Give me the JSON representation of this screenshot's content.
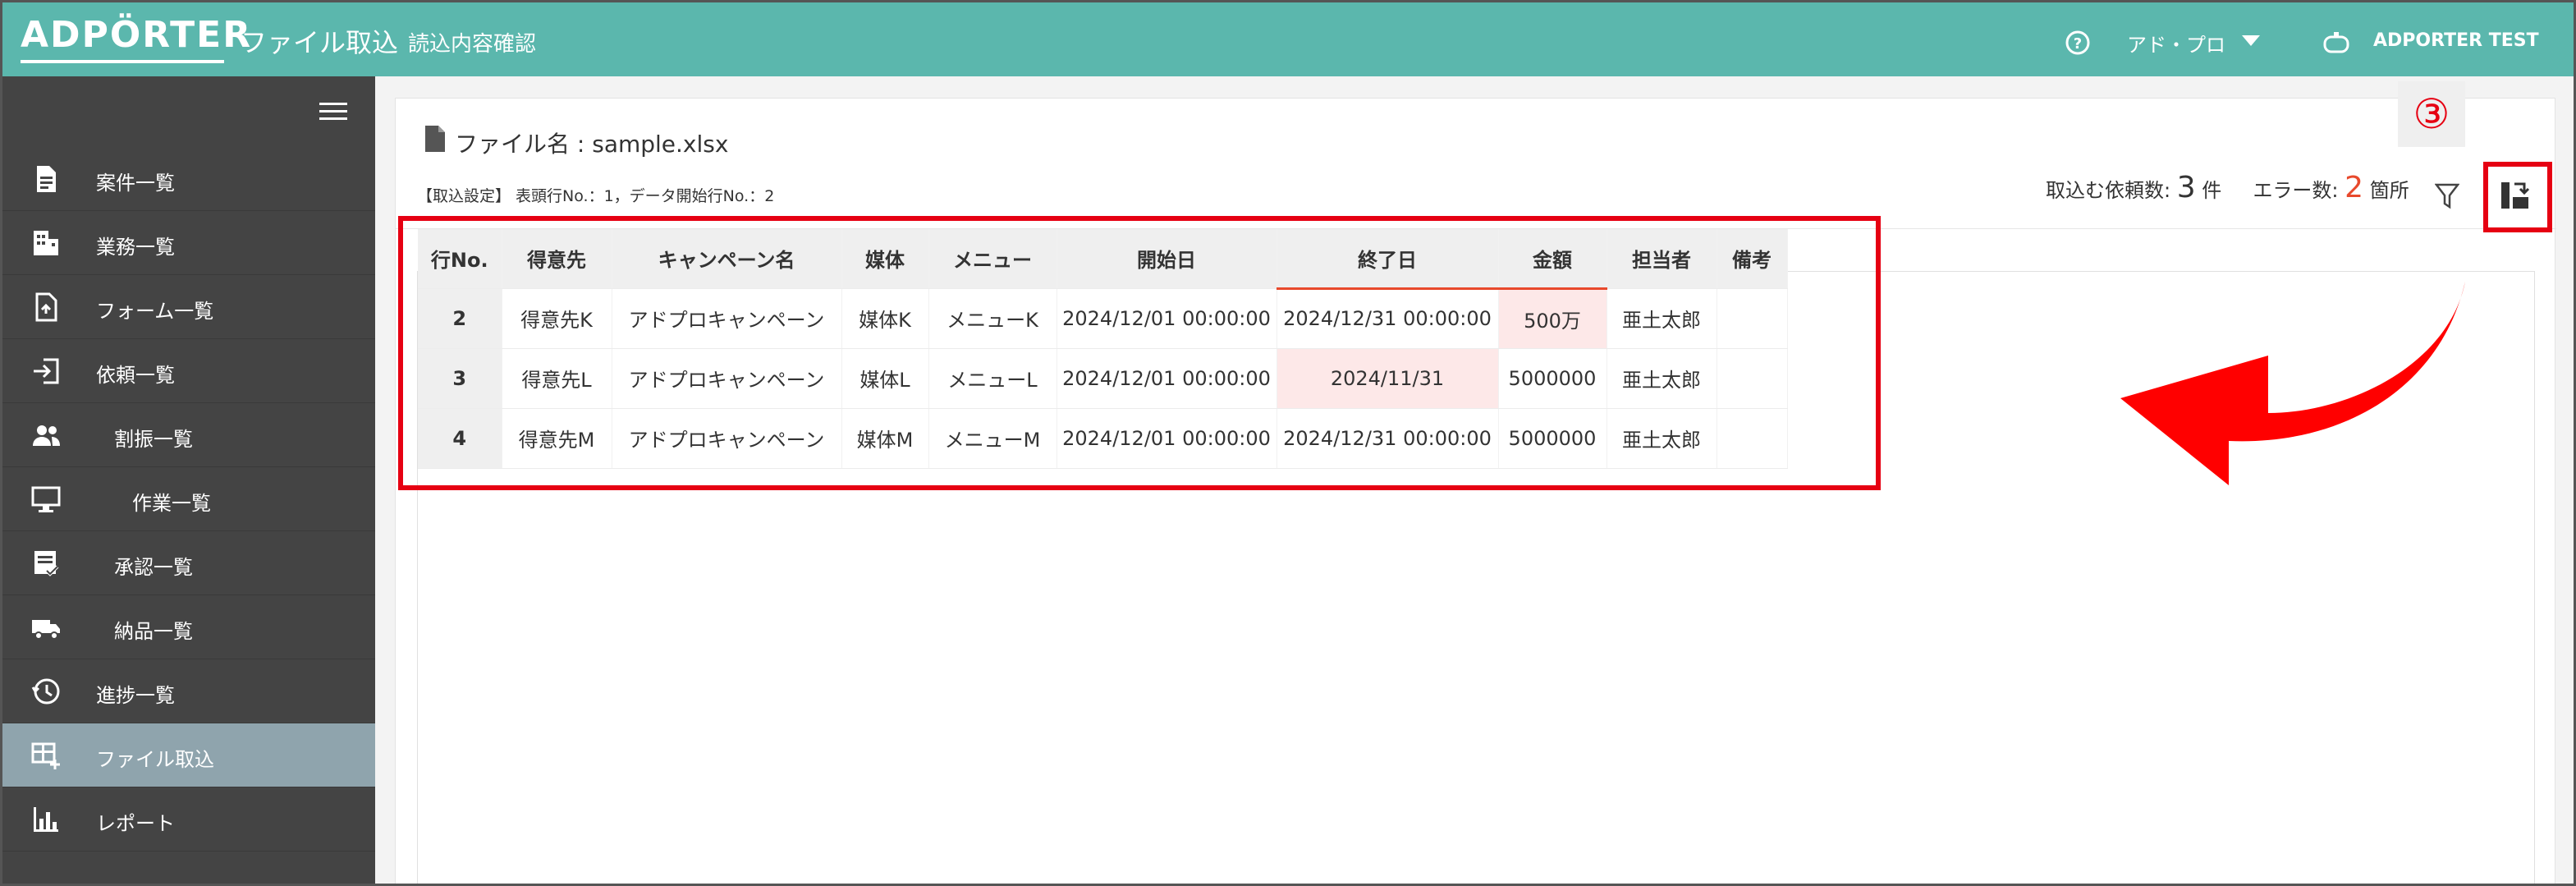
{
  "header": {
    "logo": "ADPÖRTER",
    "title": "ファイル取込",
    "subtitle": "読込内容確認",
    "org": "アド・プロ",
    "user": "ADPORTER TEST"
  },
  "sidebar": {
    "items": [
      {
        "label": "案件一覧",
        "icon": "document-list-icon"
      },
      {
        "label": "業務一覧",
        "icon": "building-icon"
      },
      {
        "label": "フォーム一覧",
        "icon": "form-file-icon"
      },
      {
        "label": "依頼一覧",
        "icon": "login-arrow-icon"
      },
      {
        "label": "割振一覧",
        "icon": "people-icon"
      },
      {
        "label": "作業一覧",
        "icon": "monitor-icon"
      },
      {
        "label": "承認一覧",
        "icon": "approval-icon"
      },
      {
        "label": "納品一覧",
        "icon": "truck-icon"
      },
      {
        "label": "進捗一覧",
        "icon": "clock-history-icon"
      },
      {
        "label": "ファイル取込",
        "icon": "table-add-icon",
        "active": true
      },
      {
        "label": "レポート",
        "icon": "bar-chart-icon"
      }
    ]
  },
  "main": {
    "file_label": "ファイル名 : sample.xlsx",
    "import_settings": "【取込設定】 表頭行No.：1，データ開始行No.：2",
    "stats": {
      "requests_label": "取込む依頼数:",
      "requests_count": "3",
      "requests_unit": "件",
      "errors_label": "エラー数:",
      "errors_count": "2",
      "errors_unit": "箇所"
    },
    "step_badge": "③"
  },
  "table": {
    "headers": [
      "行No.",
      "得意先",
      "キャンペーン名",
      "媒体",
      "メニュー",
      "開始日",
      "終了日",
      "金額",
      "担当者",
      "備考"
    ],
    "rows": [
      [
        "2",
        "得意先K",
        "アドプロキャンペーン",
        "媒体K",
        "メニューK",
        "2024/12/01 00:00:00",
        "2024/12/31 00:00:00",
        "500万",
        "亜土太郎",
        ""
      ],
      [
        "3",
        "得意先L",
        "アドプロキャンペーン",
        "媒体L",
        "メニューL",
        "2024/12/01 00:00:00",
        "2024/11/31",
        "5000000",
        "亜土太郎",
        ""
      ],
      [
        "4",
        "得意先M",
        "アドプロキャンペーン",
        "媒体M",
        "メニューM",
        "2024/12/01 00:00:00",
        "2024/12/31 00:00:00",
        "5000000",
        "亜土太郎",
        ""
      ]
    ],
    "error_cells": [
      [
        0,
        7
      ],
      [
        1,
        6
      ]
    ],
    "error_header_cols": [
      6,
      7
    ]
  },
  "colors": {
    "header_bg": "#5bb7ad",
    "sidebar_bg": "#444444",
    "sidebar_active": "#8fa4ad",
    "error": "#e8492c",
    "annotation_red": "#e60012"
  }
}
